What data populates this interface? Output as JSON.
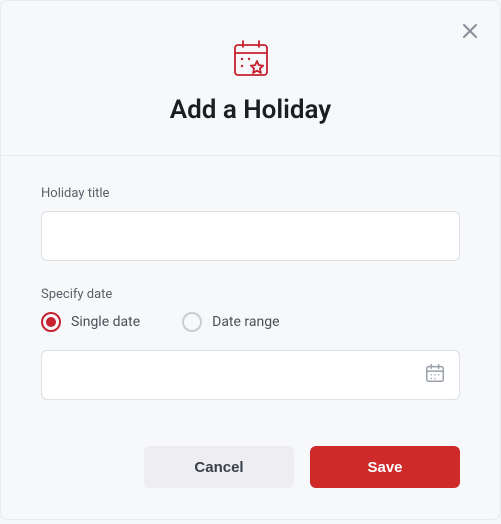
{
  "header": {
    "title": "Add a Holiday"
  },
  "form": {
    "title_label": "Holiday title",
    "title_value": "",
    "date_section_label": "Specify date",
    "radio_single": "Single date",
    "radio_range": "Date range",
    "date_value": ""
  },
  "footer": {
    "cancel": "Cancel",
    "save": "Save"
  },
  "colors": {
    "accent": "#c5212f",
    "primary_button": "#cf2a2a"
  }
}
